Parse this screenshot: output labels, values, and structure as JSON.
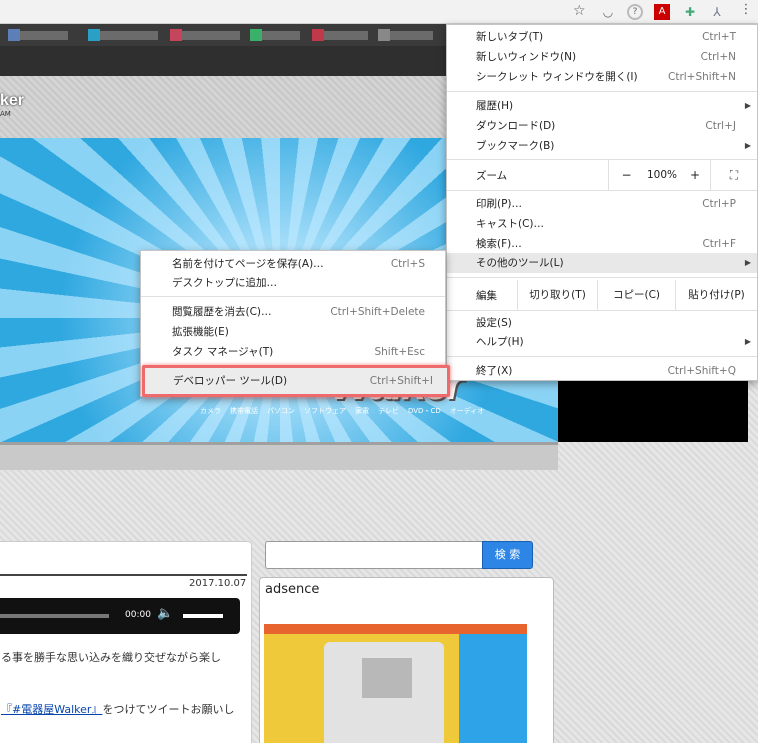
{
  "menu": {
    "items": [
      {
        "label": "新しいタブ(T)",
        "shortcut": "Ctrl+T"
      },
      {
        "label": "新しいウィンドウ(N)",
        "shortcut": "Ctrl+N"
      },
      {
        "label": "シークレット ウィンドウを開く(I)",
        "shortcut": "Ctrl+Shift+N"
      },
      {
        "label": "履歴(H)"
      },
      {
        "label": "ダウンロード(D)",
        "shortcut": "Ctrl+J"
      },
      {
        "label": "ブックマーク(B)"
      },
      {
        "label": "印刷(P)…",
        "shortcut": "Ctrl+P"
      },
      {
        "label": "キャスト(C)…"
      },
      {
        "label": "検索(F)…",
        "shortcut": "Ctrl+F"
      },
      {
        "label": "その他のツール(L)"
      },
      {
        "label": "設定(S)"
      },
      {
        "label": "ヘルプ(H)"
      },
      {
        "label": "終了(X)",
        "shortcut": "Ctrl+Shift+Q"
      }
    ],
    "zoom": {
      "label": "ズーム",
      "minus": "−",
      "value": "100%",
      "plus": "+"
    },
    "edit": {
      "label": "編集",
      "cut": "切り取り(T)",
      "copy": "コピー(C)",
      "paste": "貼り付け(P)"
    }
  },
  "submenu": {
    "items": [
      {
        "label": "名前を付けてページを保存(A)…",
        "shortcut": "Ctrl+S"
      },
      {
        "label": "デスクトップに追加…"
      },
      {
        "label": "閲覧履歴を消去(C)…",
        "shortcut": "Ctrl+Shift+Delete"
      },
      {
        "label": "拡張機能(E)"
      },
      {
        "label": "タスク マネージャ(T)",
        "shortcut": "Shift+Esc"
      },
      {
        "label": "デベロッパー ツール(D)",
        "shortcut": "Ctrl+Shift+I"
      }
    ]
  },
  "site": {
    "header_fragment": "ker",
    "header_sub": "AM",
    "banner_logo": "Walker",
    "banner_categories": [
      "カメラ",
      "携帯電話",
      "パソコン",
      "ソフトウェア",
      "家電",
      "テレビ",
      "DVD・CD",
      "オーディオ"
    ]
  },
  "article": {
    "date": "2017.10.07",
    "audio_time": "00:00",
    "text1": "る事を勝手な思い込みを織り交ぜながら楽し",
    "text2_link": "『#電器屋Walker』",
    "text2_rest": "をつけてツイートお願いし"
  },
  "sidebar": {
    "search_button": "検 索",
    "ad_label": "adsence"
  },
  "colors": {
    "highlight_border": "#ef6a6a",
    "search_button": "#2d86e6",
    "banner_blue": "#2fa8e0"
  },
  "icons": {
    "star": "☆",
    "kebab": "⋮",
    "submenu_arrow": "▶",
    "fullscreen": "⛶",
    "volume": "🔈"
  }
}
